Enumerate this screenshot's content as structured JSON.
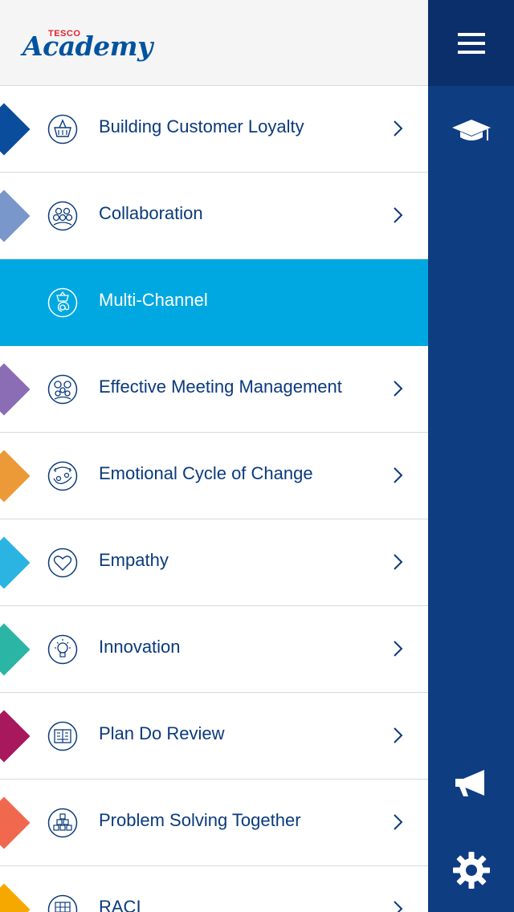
{
  "brand": {
    "tesco": "TESCO",
    "academy": "Academy",
    "tesco_color": "#e0242e",
    "academy_color": "#00539f"
  },
  "sidebar": {
    "menu_icon": "hamburger-menu-icon",
    "courses_icon": "graduation-cap-icon",
    "announcements_icon": "megaphone-icon",
    "settings_icon": "gear-icon",
    "background": "#0e3d82",
    "top_background": "#0a2f6b"
  },
  "topics": [
    {
      "label": "Building Customer Loyalty",
      "icon": "shopping-basket-icon",
      "color": "#0a4d9c",
      "active": false
    },
    {
      "label": "Collaboration",
      "icon": "people-group-icon",
      "color": "#7a97cc",
      "active": false
    },
    {
      "label": "Multi-Channel",
      "icon": "basket-at-icon",
      "color": "#00a8e1",
      "active": true
    },
    {
      "label": "Effective Meeting Management",
      "icon": "meeting-people-icon",
      "color": "#8a6db5",
      "active": false
    },
    {
      "label": "Emotional Cycle of Change",
      "icon": "cycle-change-icon",
      "color": "#ec9a38",
      "active": false
    },
    {
      "label": "Empathy",
      "icon": "heart-icon",
      "color": "#2bb4e2",
      "active": false
    },
    {
      "label": "Innovation",
      "icon": "lightbulb-icon",
      "color": "#2ab5a5",
      "active": false
    },
    {
      "label": "Plan Do Review",
      "icon": "planner-book-icon",
      "color": "#a8185c",
      "active": false
    },
    {
      "label": "Problem Solving Together",
      "icon": "team-pyramid-icon",
      "color": "#f0694e",
      "active": false
    },
    {
      "label": "RACI",
      "icon": "raci-chart-icon",
      "color": "#f6a800",
      "active": false
    }
  ]
}
